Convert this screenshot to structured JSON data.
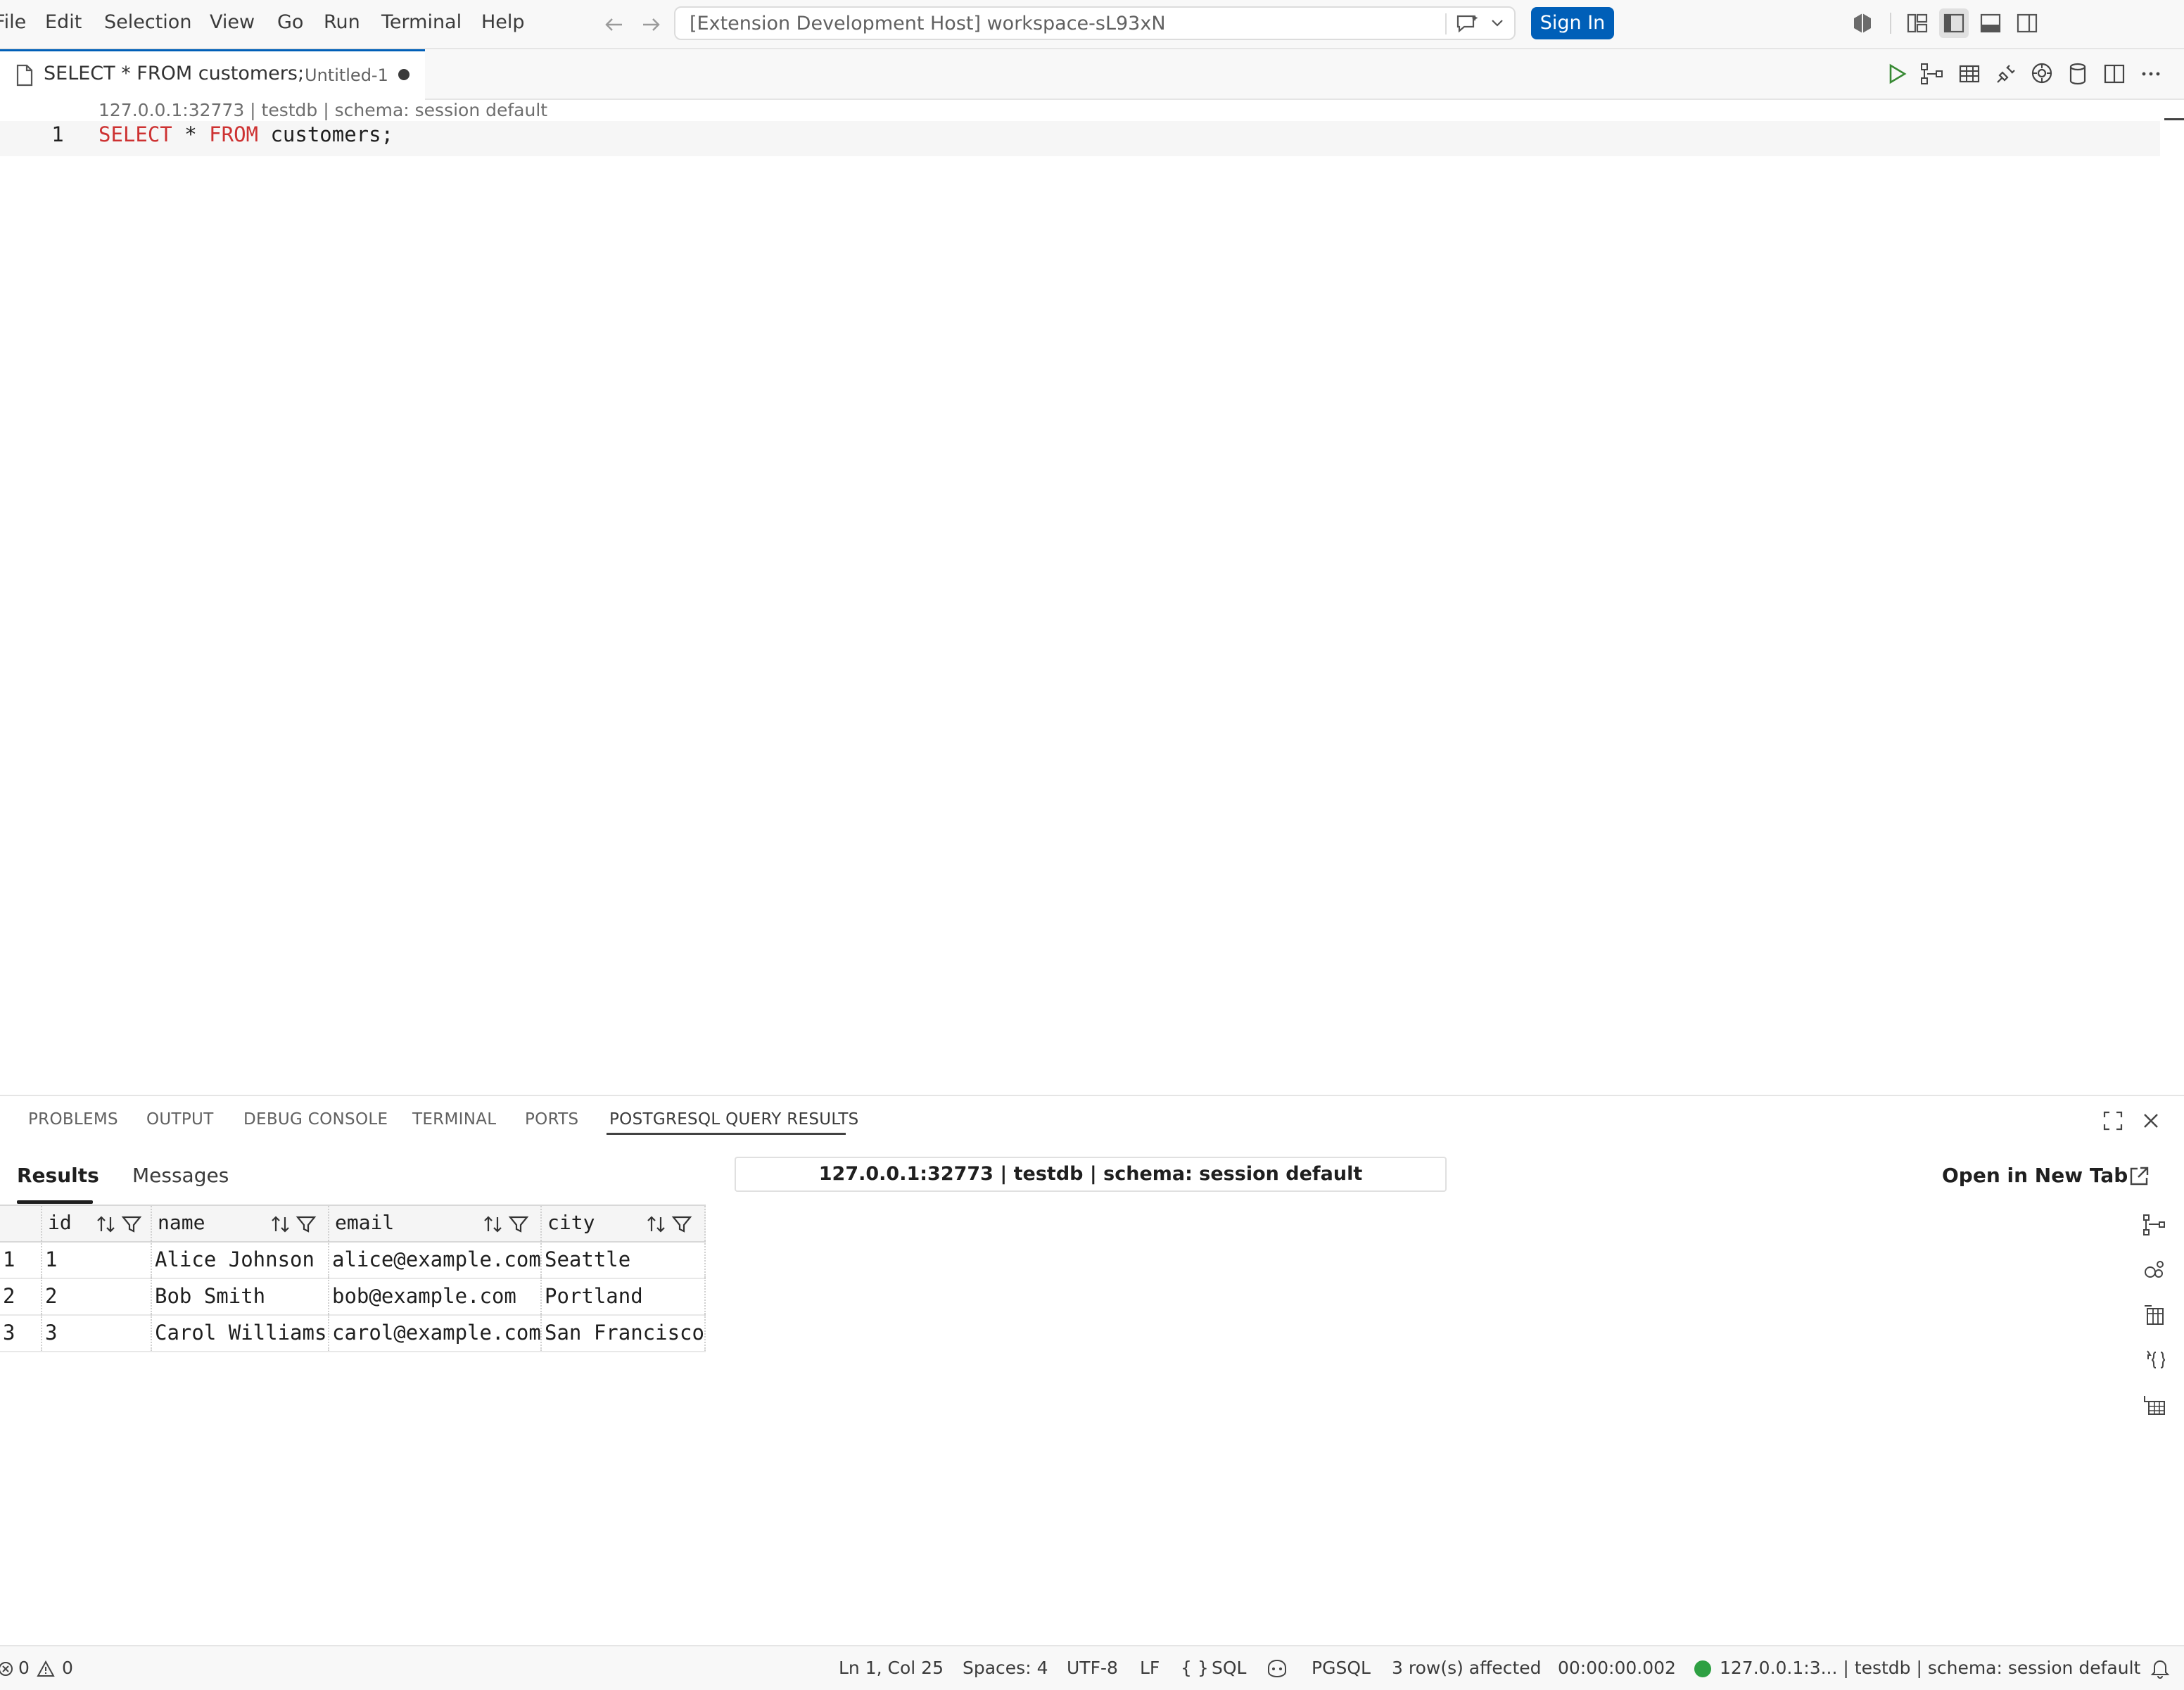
{
  "titlebar": {
    "menu": [
      "File",
      "Edit",
      "Selection",
      "View",
      "Go",
      "Run",
      "Terminal",
      "Help"
    ],
    "command_center_text": "[Extension Development Host] workspace-sL93xN",
    "sign_in_label": "Sign In"
  },
  "tab": {
    "title": "SELECT * FROM customers;",
    "description": "Untitled-1"
  },
  "editor": {
    "codelens": "127.0.0.1:32773 | testdb | schema: session default",
    "line_number": "1",
    "code": {
      "kw1": "SELECT",
      "mid": " * ",
      "kw2": "FROM",
      "rest": " customers;"
    }
  },
  "panel": {
    "tabs": [
      "PROBLEMS",
      "OUTPUT",
      "DEBUG CONSOLE",
      "TERMINAL",
      "PORTS",
      "POSTGRESQL QUERY RESULTS"
    ],
    "active_tab": "POSTGRESQL QUERY RESULTS",
    "results_tabs": [
      "Results",
      "Messages"
    ],
    "connection": "127.0.0.1:32773 | testdb | schema: session default",
    "open_new_tab_label": "Open in New Tab",
    "table": {
      "columns": [
        "id",
        "name",
        "email",
        "city"
      ],
      "rows": [
        {
          "row_num": "1",
          "id": "1",
          "name": "Alice Johnson",
          "email": "alice@example.com",
          "city": "Seattle"
        },
        {
          "row_num": "2",
          "id": "2",
          "name": "Bob Smith",
          "email": "bob@example.com",
          "city": "Portland"
        },
        {
          "row_num": "3",
          "id": "3",
          "name": "Carol Williams",
          "email": "carol@example.com",
          "city": "San Francisco"
        }
      ]
    }
  },
  "statusbar": {
    "errors": "0",
    "warnings": "0",
    "cursor": "Ln 1, Col 25",
    "spaces": "Spaces: 4",
    "encoding": "UTF-8",
    "eol": "LF",
    "language": "SQL",
    "dialect": "PGSQL",
    "rows_affected": "3 row(s) affected",
    "elapsed": "00:00:00.002",
    "connection": "127.0.0.1:3... | testdb | schema: session default"
  },
  "colors": {
    "accent": "#005fb8",
    "keyword": "#cd3131",
    "connected": "#2ea043"
  }
}
